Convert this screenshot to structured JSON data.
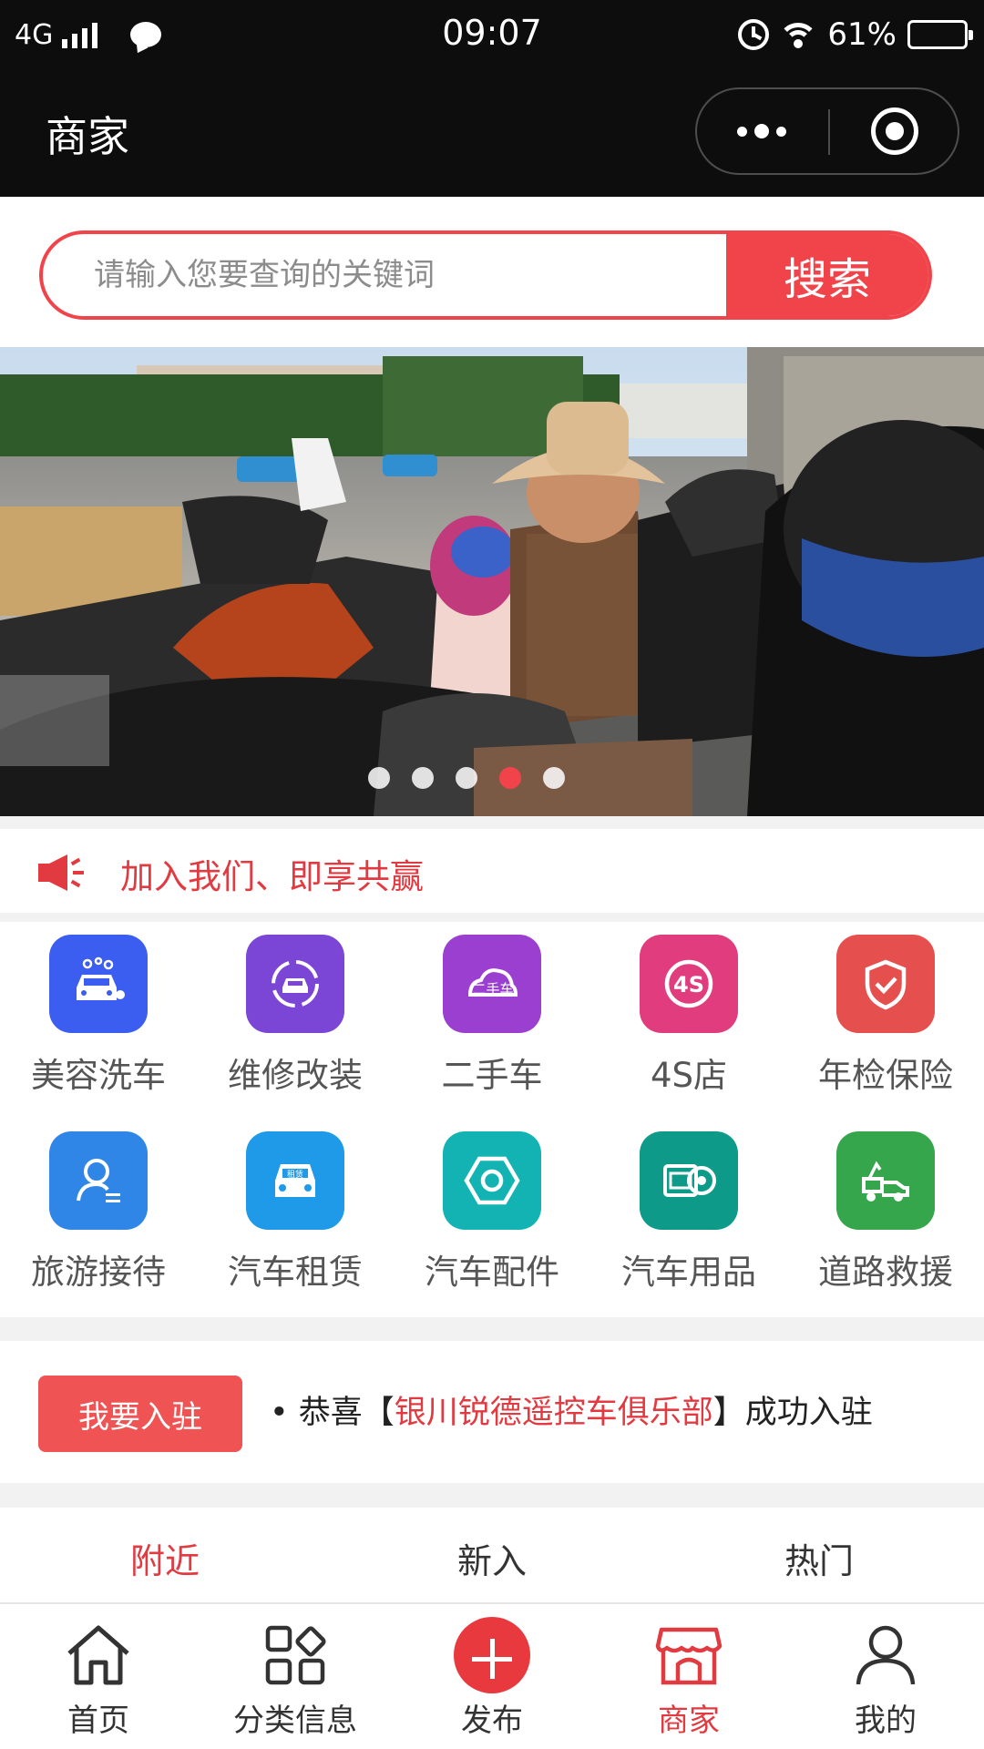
{
  "status_bar": {
    "network": "4G",
    "time": "09:07",
    "battery": "61%",
    "battery_level": 0.61
  },
  "nav": {
    "title": "商家"
  },
  "search": {
    "placeholder": "请输入您要查询的关键词",
    "button_label": "搜索"
  },
  "banner": {
    "slide_count": 5,
    "active_slide": 4
  },
  "notice": {
    "text": "加入我们、即享共赢"
  },
  "categories": [
    {
      "label": "美容洗车",
      "icon": "car-wash-icon",
      "color": "#3b5ef0"
    },
    {
      "label": "维修改装",
      "icon": "car-repair-icon",
      "color": "#7b45d6"
    },
    {
      "label": "二手车",
      "icon": "used-car-icon",
      "color": "#9b3fd1"
    },
    {
      "label": "4S店",
      "icon": "4s-store-icon",
      "color": "#e13c7d"
    },
    {
      "label": "年检保险",
      "icon": "shield-check-icon",
      "color": "#e5504e"
    },
    {
      "label": "旅游接待",
      "icon": "tour-guide-icon",
      "color": "#2f86e6"
    },
    {
      "label": "汽车租赁",
      "icon": "car-rental-icon",
      "color": "#1f9ae8"
    },
    {
      "label": "汽车配件",
      "icon": "hex-nut-icon",
      "color": "#14b3b3"
    },
    {
      "label": "汽车用品",
      "icon": "car-supplies-icon",
      "color": "#0e9a88"
    },
    {
      "label": "道路救援",
      "icon": "tow-truck-icon",
      "color": "#35a64c"
    }
  ],
  "join": {
    "button_label": "我要入驻",
    "prefix": "• 恭喜【",
    "merchant": "银川锐德遥控车俱乐部",
    "suffix": "】成功入驻"
  },
  "tabs": [
    {
      "label": "附近",
      "active": true
    },
    {
      "label": "新入",
      "active": false
    },
    {
      "label": "热门",
      "active": false
    }
  ],
  "bottom_nav": [
    {
      "label": "首页",
      "icon": "home-icon",
      "active": false
    },
    {
      "label": "分类信息",
      "icon": "category-grid-icon",
      "active": false
    },
    {
      "label": "发布",
      "icon": "plus-icon",
      "active": false
    },
    {
      "label": "商家",
      "icon": "store-icon",
      "active": true
    },
    {
      "label": "我的",
      "icon": "user-icon",
      "active": false
    }
  ],
  "colors": {
    "accent": "#f0434a",
    "text_red": "#e23a41",
    "bar_dark": "#0d0d0d"
  }
}
